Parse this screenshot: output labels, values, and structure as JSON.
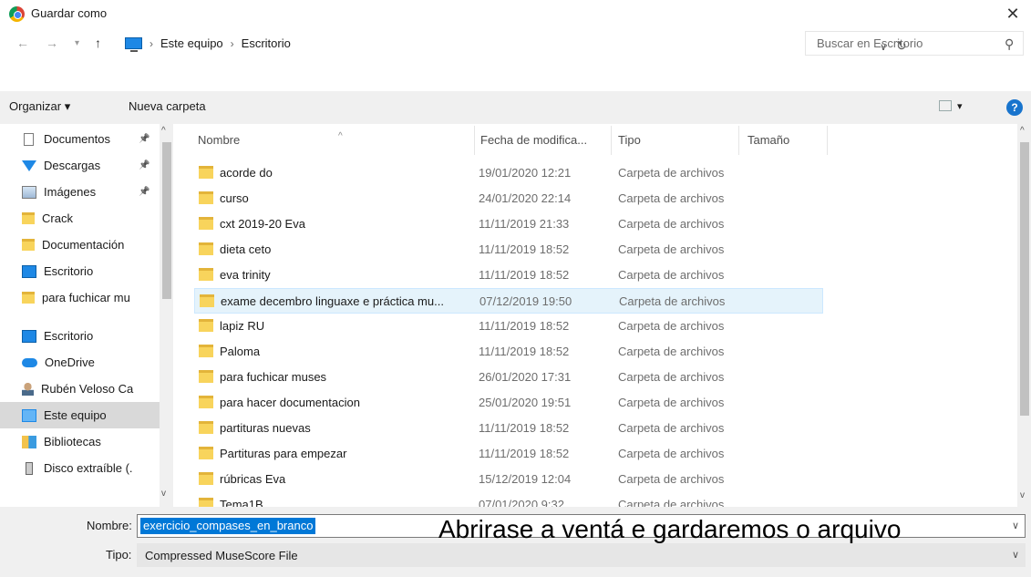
{
  "window": {
    "title": "Guardar como",
    "close_glyph": "✕"
  },
  "address": {
    "breadcrumbs": [
      "Este equipo",
      "Escritorio"
    ],
    "search_placeholder": "Buscar en Escritorio"
  },
  "toolbar": {
    "organize": "Organizar ▾",
    "new_folder": "Nueva carpeta",
    "help": "?"
  },
  "nav": {
    "items": [
      {
        "label": "Documentos",
        "icon": "document-icon",
        "pinned": true
      },
      {
        "label": "Descargas",
        "icon": "download-icon",
        "pinned": true
      },
      {
        "label": "Imágenes",
        "icon": "images-icon",
        "pinned": true
      },
      {
        "label": "Crack",
        "icon": "folder-icon"
      },
      {
        "label": "Documentación",
        "icon": "folder-icon"
      },
      {
        "label": "Escritorio",
        "icon": "desktop-icon"
      },
      {
        "label": "para fuchicar mu",
        "icon": "folder-icon"
      },
      {
        "label": "Escritorio",
        "icon": "desktop-icon"
      },
      {
        "label": "OneDrive",
        "icon": "cloud-icon"
      },
      {
        "label": "Rubén Veloso Ca",
        "icon": "user-icon"
      },
      {
        "label": "Este equipo",
        "icon": "computer-icon",
        "selected": true
      },
      {
        "label": "Bibliotecas",
        "icon": "library-icon"
      },
      {
        "label": "Disco extraíble (.",
        "icon": "usb-drive-icon"
      }
    ]
  },
  "columns": {
    "name": "Nombre",
    "date": "Fecha de modifica...",
    "type": "Tipo",
    "size": "Tamaño"
  },
  "files": [
    {
      "name": "acorde do",
      "date": "19/01/2020 12:21",
      "type": "Carpeta de archivos"
    },
    {
      "name": "curso",
      "date": "24/01/2020 22:14",
      "type": "Carpeta de archivos"
    },
    {
      "name": "cxt 2019-20 Eva",
      "date": "11/11/2019 21:33",
      "type": "Carpeta de archivos"
    },
    {
      "name": "dieta ceto",
      "date": "11/11/2019 18:52",
      "type": "Carpeta de archivos"
    },
    {
      "name": "eva trinity",
      "date": "11/11/2019 18:52",
      "type": "Carpeta de archivos"
    },
    {
      "name": "exame decembro linguaxe e práctica mu...",
      "date": "07/12/2019 19:50",
      "type": "Carpeta de archivos",
      "hover": true
    },
    {
      "name": "lapiz RU",
      "date": "11/11/2019 18:52",
      "type": "Carpeta de archivos"
    },
    {
      "name": "Paloma",
      "date": "11/11/2019 18:52",
      "type": "Carpeta de archivos"
    },
    {
      "name": "para fuchicar muses",
      "date": "26/01/2020 17:31",
      "type": "Carpeta de archivos"
    },
    {
      "name": "para hacer documentacion",
      "date": "25/01/2020 19:51",
      "type": "Carpeta de archivos"
    },
    {
      "name": "partituras nuevas",
      "date": "11/11/2019 18:52",
      "type": "Carpeta de archivos"
    },
    {
      "name": "Partituras para empezar",
      "date": "11/11/2019 18:52",
      "type": "Carpeta de archivos"
    },
    {
      "name": "rúbricas Eva",
      "date": "15/12/2019 12:04",
      "type": "Carpeta de archivos"
    },
    {
      "name": "Tema1B",
      "date": "07/01/2020 9:32",
      "type": "Carpeta de archivos"
    }
  ],
  "save": {
    "name_label": "Nombre:",
    "name_value": "exercicio_compases_en_branco",
    "type_label": "Tipo:",
    "type_value": "Compressed MuseScore File",
    "annotation": "Abrirase a ventá e gardaremos o arquivo"
  }
}
